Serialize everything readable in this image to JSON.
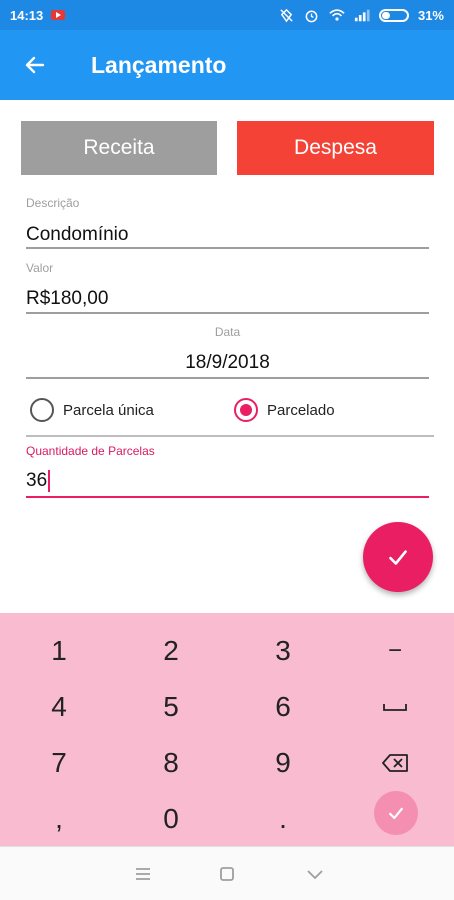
{
  "status_bar": {
    "time": "14:13",
    "battery": "31%"
  },
  "app_bar": {
    "title": "Lançamento",
    "back_icon": "arrow-left-icon"
  },
  "type_buttons": {
    "receita": "Receita",
    "despesa": "Despesa",
    "receita_color": "#9e9e9e",
    "despesa_color": "#f44336"
  },
  "form": {
    "descricao_label": "Descrição",
    "descricao_value": "Condomínio",
    "valor_label": "Valor",
    "valor_value": "R$180,00",
    "data_label": "Data",
    "data_value": "18/9/2018",
    "radio_unica": "Parcela única",
    "radio_parcelado": "Parcelado",
    "selected_radio": "Parcelado",
    "parcelas_label": "Quantidade de Parcelas",
    "parcelas_value": "36"
  },
  "keypad": {
    "keys": [
      "1",
      "2",
      "3",
      "−",
      "4",
      "5",
      "6",
      "␣",
      "7",
      "8",
      "9",
      "⌫",
      ",",
      "0",
      "."
    ],
    "accent": "#e91e63"
  }
}
